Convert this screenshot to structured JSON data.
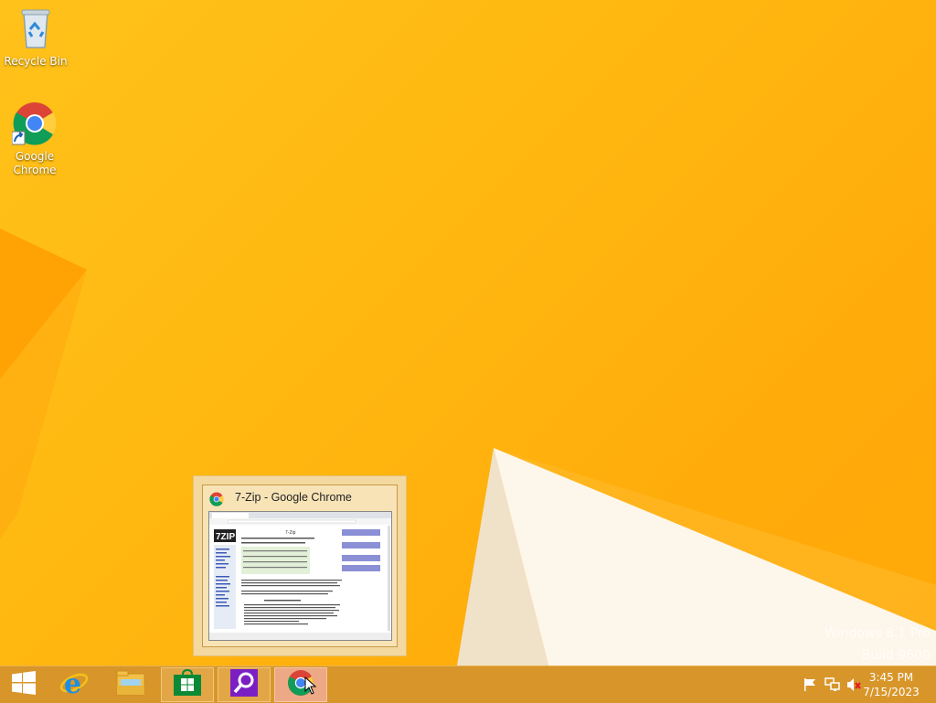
{
  "desktop": {
    "icons": [
      {
        "label": "Recycle Bin",
        "icon": "recycle-bin-icon"
      },
      {
        "label": "Google\nChrome",
        "label_line1": "Google",
        "label_line2": "Chrome",
        "icon": "chrome-icon"
      }
    ],
    "watermark": {
      "line1": "Windows 8.1 Pro",
      "line2": "Build 9600"
    }
  },
  "thumbnail": {
    "title": "7-Zip - Google Chrome",
    "icon": "chrome-icon",
    "page_heading": "7-Zip",
    "page_logo": "7zip"
  },
  "taskbar": {
    "buttons": [
      {
        "name": "start-button",
        "icon": "windows-logo-icon"
      },
      {
        "name": "internet-explorer",
        "icon": "ie-icon"
      },
      {
        "name": "file-explorer",
        "icon": "folder-icon"
      },
      {
        "name": "store",
        "icon": "store-icon"
      },
      {
        "name": "search",
        "icon": "magnifier-icon"
      },
      {
        "name": "google-chrome",
        "icon": "chrome-icon"
      }
    ],
    "tray_icons": [
      "flag-icon",
      "network-icon",
      "speaker-muted-icon"
    ],
    "clock": {
      "time": "3:45 PM",
      "date": "7/15/2023"
    }
  },
  "colors": {
    "wallpaper": "#ffb810",
    "taskbar": "#d8962a",
    "popup": "#f3d9a0"
  }
}
